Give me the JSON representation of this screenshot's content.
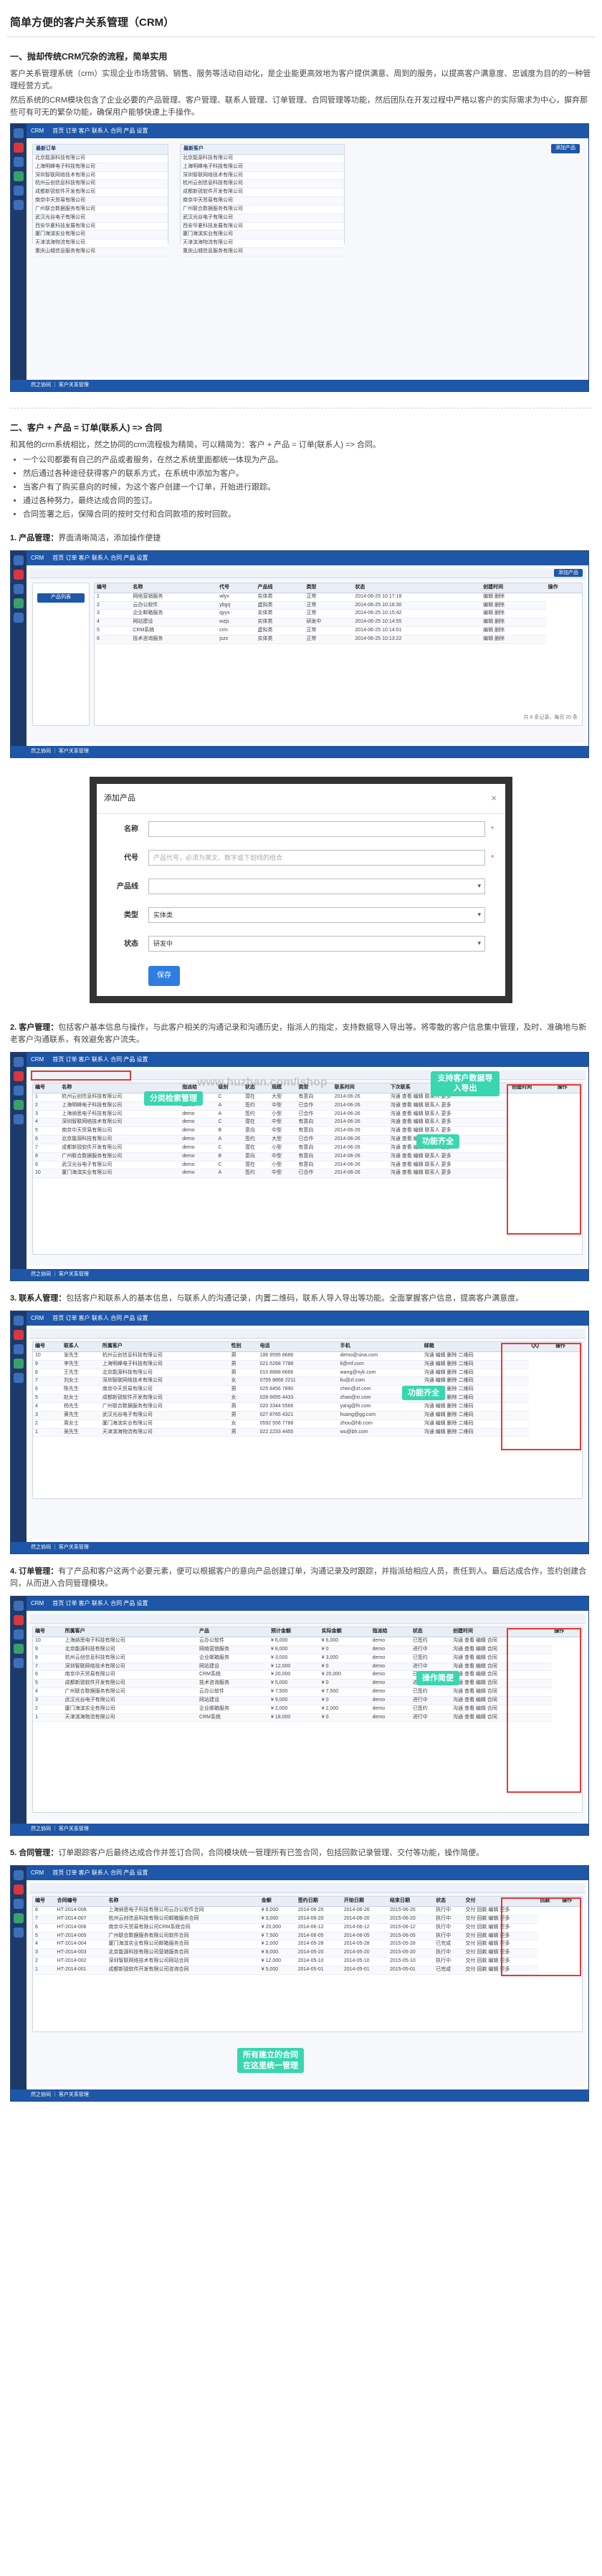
{
  "title": "简单方便的客户关系管理（CRM）",
  "s1": {
    "heading": "一、抛却传统CRM冗杂的流程，简单实用",
    "p1": "客户关系管理系统（crm）实现企业市场营销、销售、服务等活动自动化，是企业能更高效地为客户提供满意、周到的服务，以提高客户满意度、忠诚度为目的的一种管理经营方式。",
    "p2": "然后系统的CRM模块包含了企业必要的产品管理、客户管理、联系人管理、订单管理、合同管理等功能，然后团队在开发过程中严格以客户的实际需求为中心，摒弃那些可有可无的繁杂功能，确保用户能够快速上手操作。"
  },
  "s2": {
    "heading": "二、客户 + 产品 = 订单(联系人) => 合同",
    "p1": "和其他的crm系统相比，然之协同的crm流程极为精简，可以精简为：客户 + 产品 = 订单(联系人) => 合同。",
    "bullets": [
      "一个公司都要有自己的产品或者服务，在然之系统里面都统一体现为产品。",
      "然后通过各种途径获得客户的联系方式，在系统中添加为客户。",
      "当客户有了购买意向的时候，为这个客户创建一个订单，开始进行跟踪。",
      "通过各种努力，最终达成合同的签订。",
      "合同签署之后，保障合同的按时交付和合同款项的按时回款。"
    ]
  },
  "s_product": {
    "label": "1. 产品管理：",
    "text": "界面清晰简洁，添加操作便捷"
  },
  "s_customer": {
    "label": "2. 客户管理：",
    "text": "包括客户基本信息与操作，与此客户相关的沟通记录和沟通历史，指派人的指定，支持数据导入导出等。将零散的客户信息集中管理，及时、准确地与新老客户沟通联系，有效避免客户流失。"
  },
  "s_contact": {
    "label": "3. 联系人管理：",
    "text": "包括客户和联系人的基本信息，与联系人的沟通记录，内置二维码，联系人导入导出等功能。全面掌握客户信息，提高客户满意度。"
  },
  "s_order": {
    "label": "4. 订单管理：",
    "text": "有了产品和客户这两个必要元素，便可以根据客户的意向产品创建订单，沟通记录及时跟踪，并指派给相应人员，责任到人。最后达成合作，签约创建合同，从而进入合同管理模块。"
  },
  "s_contract": {
    "label": "5. 合同管理：",
    "text": "订单跟踪客户后最终达成合作并签订合同，合同模块统一管理所有已签合同，包括回款记录管理、交付等功能，操作简便。"
  },
  "app": {
    "brand": "CRM",
    "nav": [
      "首页",
      "订单",
      "客户",
      "联系人",
      "合同",
      "产品",
      "设置"
    ],
    "nav_cols": [
      "订单",
      "客户",
      "联系人",
      "合同"
    ],
    "footer": "然之协同 ｜ 客户关系管理",
    "add_product": "添加产品",
    "search": "搜索"
  },
  "shot1": {
    "left_title": "最新订单",
    "right_title": "最新客户",
    "rows": [
      "北京能源科技有限公司",
      "上海明峰电子科技有限公司",
      "深圳智联网络技术有限公司",
      "杭州云创信息科技有限公司",
      "成都新锐软件开发有限公司",
      "南京中天贸易有限公司",
      "广州联合数据服务有限公司",
      "武汉光谷电子有限公司",
      "西安华夏科技发展有限公司",
      "厦门海滨实业有限公司",
      "天津滨海物流有限公司",
      "重庆山城信息服务有限公司"
    ]
  },
  "shot2": {
    "sidebar_item": "产品列表",
    "cols": [
      "编号",
      "名称",
      "代号",
      "产品线",
      "类型",
      "状态",
      "创建时间",
      "操作"
    ],
    "rows": [
      [
        "1",
        "网络营销服务",
        "wlyx",
        "实体类",
        "正常",
        "2014-06-25 10:17:18"
      ],
      [
        "2",
        "云办公软件",
        "ybgrj",
        "虚拟类",
        "正常",
        "2014-06-25 10:16:30"
      ],
      [
        "3",
        "企业邮箱服务",
        "qyyx",
        "实体类",
        "正常",
        "2014-06-25 10:15:42"
      ],
      [
        "4",
        "网站建设",
        "wzjs",
        "实体类",
        "研发中",
        "2014-06-25 10:14:55"
      ],
      [
        "5",
        "CRM系统",
        "crm",
        "虚拟类",
        "正常",
        "2014-06-25 10:14:01"
      ],
      [
        "6",
        "技术咨询服务",
        "jszx",
        "实体类",
        "正常",
        "2014-06-25 10:13:22"
      ]
    ],
    "pager": "共 6 条记录，每页 20 条"
  },
  "dialog": {
    "title": "添加产品",
    "name_label": "名称",
    "code_label": "代号",
    "code_placeholder": "产品代号，必须为英文、数字或下划线的组合",
    "line_label": "产品线",
    "type_label": "类型",
    "type_value": "实体类",
    "status_label": "状态",
    "status_value": "研发中",
    "save": "保存",
    "close": "×"
  },
  "shot3": {
    "cols": [
      "编号",
      "名称",
      "指派给",
      "级别",
      "状态",
      "规模",
      "类型",
      "联系时间",
      "下次联系",
      "创建时间",
      "操作"
    ],
    "rows": [
      [
        "1",
        "杭州云创信息科技有限公司",
        "demo",
        "C",
        "潜在",
        "大型",
        "有意向",
        "2014-06-26"
      ],
      [
        "2",
        "上海明峰电子科技有限公司",
        "demo",
        "A",
        "签约",
        "中型",
        "已合作",
        "2014-06-26"
      ],
      [
        "3",
        "上海纳思电子科技有限公司",
        "demo",
        "A",
        "签约",
        "小型",
        "已合作",
        "2014-06-26"
      ],
      [
        "4",
        "深圳智联网络技术有限公司",
        "demo",
        "C",
        "潜在",
        "中型",
        "有意向",
        "2014-06-26"
      ],
      [
        "5",
        "南京中天贸易有限公司",
        "demo",
        "B",
        "意向",
        "中型",
        "有意向",
        "2014-06-26"
      ],
      [
        "6",
        "北京能源科技有限公司",
        "demo",
        "A",
        "签约",
        "大型",
        "已合作",
        "2014-06-26"
      ],
      [
        "7",
        "成都新锐软件开发有限公司",
        "demo",
        "C",
        "潜在",
        "小型",
        "有意向",
        "2014-06-26"
      ],
      [
        "8",
        "广州联合数据服务有限公司",
        "demo",
        "B",
        "意向",
        "中型",
        "有意向",
        "2014-06-26"
      ],
      [
        "9",
        "武汉光谷电子有限公司",
        "demo",
        "C",
        "潜在",
        "小型",
        "有意向",
        "2014-06-26"
      ],
      [
        "10",
        "厦门海滨实业有限公司",
        "demo",
        "A",
        "签约",
        "中型",
        "已合作",
        "2014-06-26"
      ]
    ],
    "callout_search": "分类检索管理",
    "callout_import": "支持客户数据导入导出",
    "callout_ops": "功能齐全",
    "ops": "沟通 查看 编辑 联系人 更多"
  },
  "shot4": {
    "cols": [
      "编号",
      "联系人",
      "所属客户",
      "性别",
      "电话",
      "手机",
      "邮箱",
      "QQ",
      "操作"
    ],
    "rows": [
      [
        "10",
        "张先生",
        "杭州云创信息科技有限公司",
        "男",
        "186 9595 8686",
        "demo@sina.com"
      ],
      [
        "9",
        "李先生",
        "上海明峰电子科技有限公司",
        "男",
        "021 5268 7788",
        "li@mf.com"
      ],
      [
        "8",
        "王先生",
        "北京能源科技有限公司",
        "男",
        "010 8888 6666",
        "wang@nyk.com"
      ],
      [
        "7",
        "刘女士",
        "深圳智联网络技术有限公司",
        "女",
        "0755 8866 2211",
        "liu@zl.com"
      ],
      [
        "6",
        "陈先生",
        "南京中天贸易有限公司",
        "男",
        "025 8456 7890",
        "chen@zt.com"
      ],
      [
        "5",
        "赵女士",
        "成都新锐软件开发有限公司",
        "女",
        "028 6655 4433",
        "zhao@xr.com"
      ],
      [
        "4",
        "杨先生",
        "广州联合数据服务有限公司",
        "男",
        "020 3344 5566",
        "yang@lh.com"
      ],
      [
        "3",
        "黄先生",
        "武汉光谷电子有限公司",
        "男",
        "027 8765 4321",
        "huang@gg.com"
      ],
      [
        "2",
        "周女士",
        "厦门海滨实业有限公司",
        "女",
        "0592 556 7788",
        "zhou@hb.com"
      ],
      [
        "1",
        "吴先生",
        "天津滨海物流有限公司",
        "男",
        "022 2233 4455",
        "wu@bh.com"
      ]
    ],
    "callout": "功能齐全",
    "ops": "沟通 编辑 删除 二维码"
  },
  "shot5": {
    "cols": [
      "编号",
      "所属客户",
      "产品",
      "预计金额",
      "实际金额",
      "指派给",
      "状态",
      "创建时间",
      "操作"
    ],
    "rows": [
      [
        "10",
        "上海纳思电子科技有限公司",
        "云办公软件",
        "¥ 6,000",
        "¥ 6,000",
        "demo",
        "已签约"
      ],
      [
        "9",
        "北京能源科技有限公司",
        "网络营销服务",
        "¥ 8,000",
        "¥ 0",
        "demo",
        "进行中"
      ],
      [
        "8",
        "杭州云创信息科技有限公司",
        "企业邮箱服务",
        "¥ 3,000",
        "¥ 3,000",
        "demo",
        "已签约"
      ],
      [
        "7",
        "深圳智联网络技术有限公司",
        "网站建设",
        "¥ 12,000",
        "¥ 0",
        "demo",
        "进行中"
      ],
      [
        "6",
        "南京中天贸易有限公司",
        "CRM系统",
        "¥ 20,000",
        "¥ 20,000",
        "demo",
        "已签约"
      ],
      [
        "5",
        "成都新锐软件开发有限公司",
        "技术咨询服务",
        "¥ 5,000",
        "¥ 0",
        "demo",
        "进行中"
      ],
      [
        "4",
        "广州联合数据服务有限公司",
        "云办公软件",
        "¥ 7,500",
        "¥ 7,500",
        "demo",
        "已签约"
      ],
      [
        "3",
        "武汉光谷电子有限公司",
        "网站建设",
        "¥ 9,000",
        "¥ 0",
        "demo",
        "进行中"
      ],
      [
        "2",
        "厦门海滨实业有限公司",
        "企业邮箱服务",
        "¥ 2,000",
        "¥ 2,000",
        "demo",
        "已签约"
      ],
      [
        "1",
        "天津滨海物流有限公司",
        "CRM系统",
        "¥ 18,000",
        "¥ 0",
        "demo",
        "进行中"
      ]
    ],
    "callout": "操作简便",
    "ops": "沟通 查看 编辑 合同"
  },
  "shot6": {
    "cols": [
      "编号",
      "合同编号",
      "名称",
      "金额",
      "签约日期",
      "开始日期",
      "结束日期",
      "状态",
      "交付",
      "回款",
      "操作"
    ],
    "rows": [
      [
        "8",
        "HT-2014-008",
        "上海纳思电子科技有限公司云办公软件合同",
        "¥ 6,000",
        "2014-06-26",
        "2014-06-26",
        "2015-06-26",
        "执行中"
      ],
      [
        "7",
        "HT-2014-007",
        "杭州云创信息科技有限公司邮箱服务合同",
        "¥ 3,000",
        "2014-06-20",
        "2014-06-20",
        "2015-06-20",
        "执行中"
      ],
      [
        "6",
        "HT-2014-006",
        "南京中天贸易有限公司CRM系统合同",
        "¥ 20,000",
        "2014-06-12",
        "2014-06-12",
        "2015-06-12",
        "执行中"
      ],
      [
        "5",
        "HT-2014-005",
        "广州联合数据服务有限公司软件合同",
        "¥ 7,500",
        "2014-06-05",
        "2014-06-05",
        "2015-06-05",
        "执行中"
      ],
      [
        "4",
        "HT-2014-004",
        "厦门海滨实业有限公司邮箱服务合同",
        "¥ 2,000",
        "2014-05-28",
        "2014-05-28",
        "2015-05-28",
        "已完成"
      ],
      [
        "3",
        "HT-2014-003",
        "北京能源科技有限公司营销服务合同",
        "¥ 8,000",
        "2014-05-20",
        "2014-05-20",
        "2015-05-20",
        "执行中"
      ],
      [
        "2",
        "HT-2014-002",
        "深圳智联网络技术有限公司网站合同",
        "¥ 12,000",
        "2014-05-10",
        "2014-05-10",
        "2015-05-10",
        "执行中"
      ],
      [
        "1",
        "HT-2014-001",
        "成都新锐软件开发有限公司咨询合同",
        "¥ 5,000",
        "2014-05-01",
        "2014-05-01",
        "2015-05-01",
        "已完成"
      ]
    ],
    "callout": "所有建立的合同\n在这里统一管理",
    "ops": "交付 回款 编辑 更多"
  },
  "watermark": "www.huzhan.com/ishop"
}
